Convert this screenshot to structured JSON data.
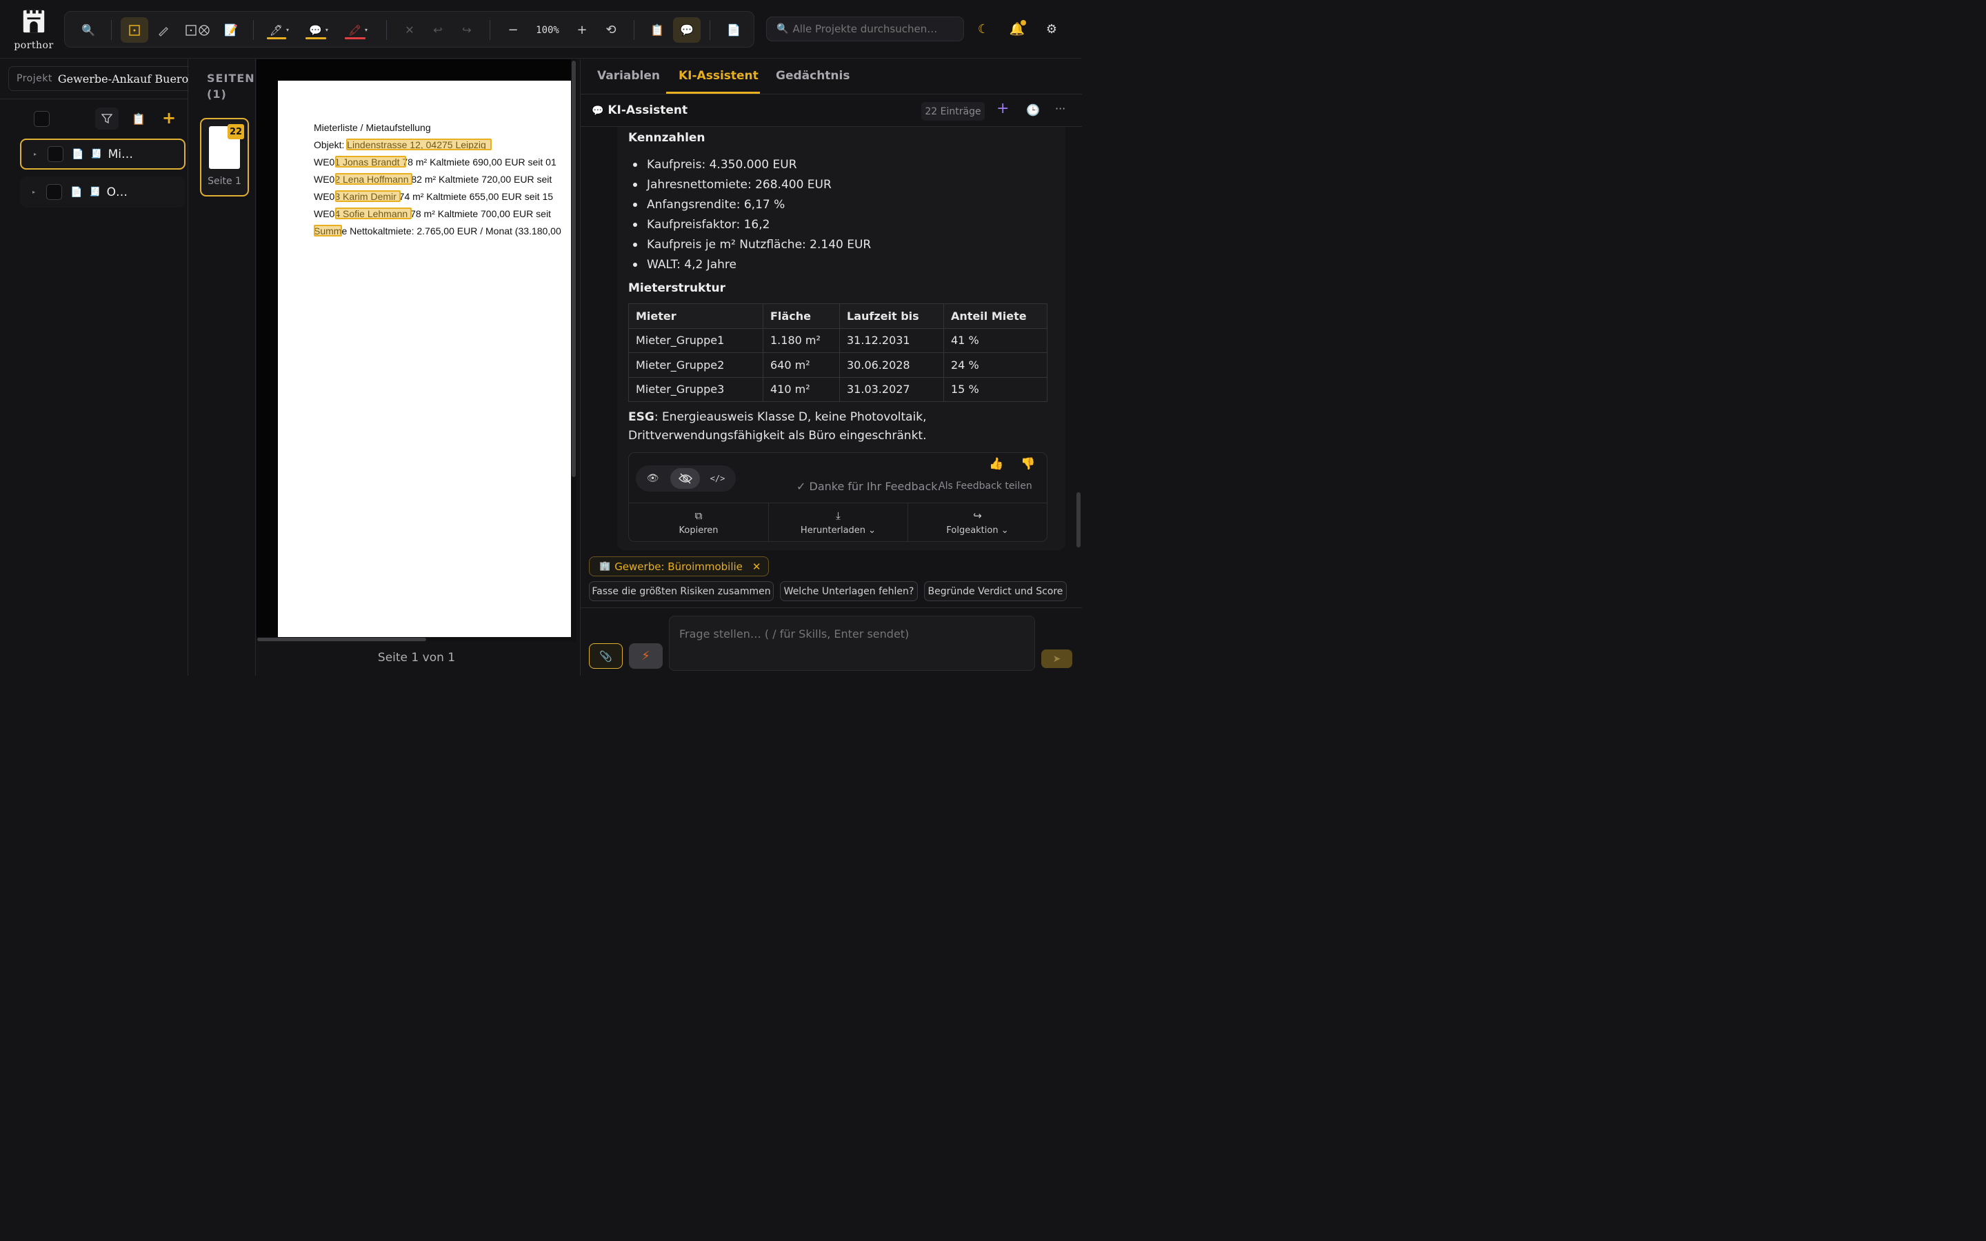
{
  "app": {
    "name": "porthor"
  },
  "toolbar": {
    "zoom": "100%"
  },
  "search": {
    "placeholder": "Alle Projekte durchsuchen…"
  },
  "left": {
    "project_label": "Projekt",
    "project_name": "Gewerbe-Ankauf Buerohaus",
    "files": [
      {
        "name": "Mi…"
      },
      {
        "name": "O…"
      }
    ]
  },
  "pages": {
    "title_line1": "SEITEN",
    "title_line2": "(1)",
    "badge": "22",
    "thumb_label": "Seite 1",
    "footer": "Seite 1 von 1"
  },
  "document": {
    "lines": [
      "Mieterliste / Mietaufstellung",
      "Objekt: Lindenstrasse 12, 04275 Leipzig",
      "WE01  Jonas Brandt  78 m²  Kaltmiete 690,00 EUR  seit 01",
      "WE02  Lena Hoffmann  82 m²  Kaltmiete 720,00 EUR  seit",
      "WE03  Karim Demir  74 m²  Kaltmiete 655,00 EUR  seit 15",
      "WE04  Sofie Lehmann  78 m²  Kaltmiete 700,00 EUR  seit",
      "Summe Nettokaltmiete: 2.765,00 EUR / Monat  (33.180,00"
    ]
  },
  "right": {
    "tabs": [
      "Variablen",
      "KI-Assistent",
      "Gedächtnis"
    ],
    "header_title": "KI-Assistent",
    "count": "22 Einträge",
    "kennzahlen_title": "Kennzahlen",
    "kennzahlen": [
      "Kaufpreis: 4.350.000 EUR",
      "Jahresnettomiete: 268.400 EUR",
      "Anfangsrendite: 6,17 %",
      "Kaufpreisfaktor: 16,2",
      "Kaufpreis je m² Nutzfläche: 2.140 EUR",
      "WALT: 4,2 Jahre"
    ],
    "mieter_title": "Mieterstruktur",
    "table": {
      "headers": [
        "Mieter",
        "Fläche",
        "Laufzeit bis",
        "Anteil Miete"
      ],
      "rows": [
        [
          "Mieter_Gruppe1",
          "1.180 m²",
          "31.12.2031",
          "41 %"
        ],
        [
          "Mieter_Gruppe2",
          "640 m²",
          "30.06.2028",
          "24 %"
        ],
        [
          "Mieter_Gruppe3",
          "410 m²",
          "31.03.2027",
          "15 %"
        ]
      ]
    },
    "esg_label": "ESG",
    "esg_text": ": Energieausweis Klasse D, keine Photovoltaik, Drittverwendungsfähigkeit als Büro eingeschränkt.",
    "feedback_text": "✓ Danke für Ihr Feedback.",
    "feedback_link": "Als Feedback teilen",
    "actions": [
      "Kopieren",
      "Herunterladen",
      "Folgeaktion"
    ],
    "context_chip": "Gewerbe: Büroimmobilie",
    "suggestions": [
      "Fasse die größten Risiken zusammen",
      "Welche Unterlagen fehlen?",
      "Begründe Verdict und Score"
    ],
    "input_placeholder": "Frage stellen… ( / für Skills, Enter sendet)"
  },
  "colors": {
    "accent": "#e8b020",
    "background": "#141416",
    "highlight_blue": "#5b8def",
    "highlight_yellow": "#e8b020",
    "highlight_red": "#e04040"
  }
}
